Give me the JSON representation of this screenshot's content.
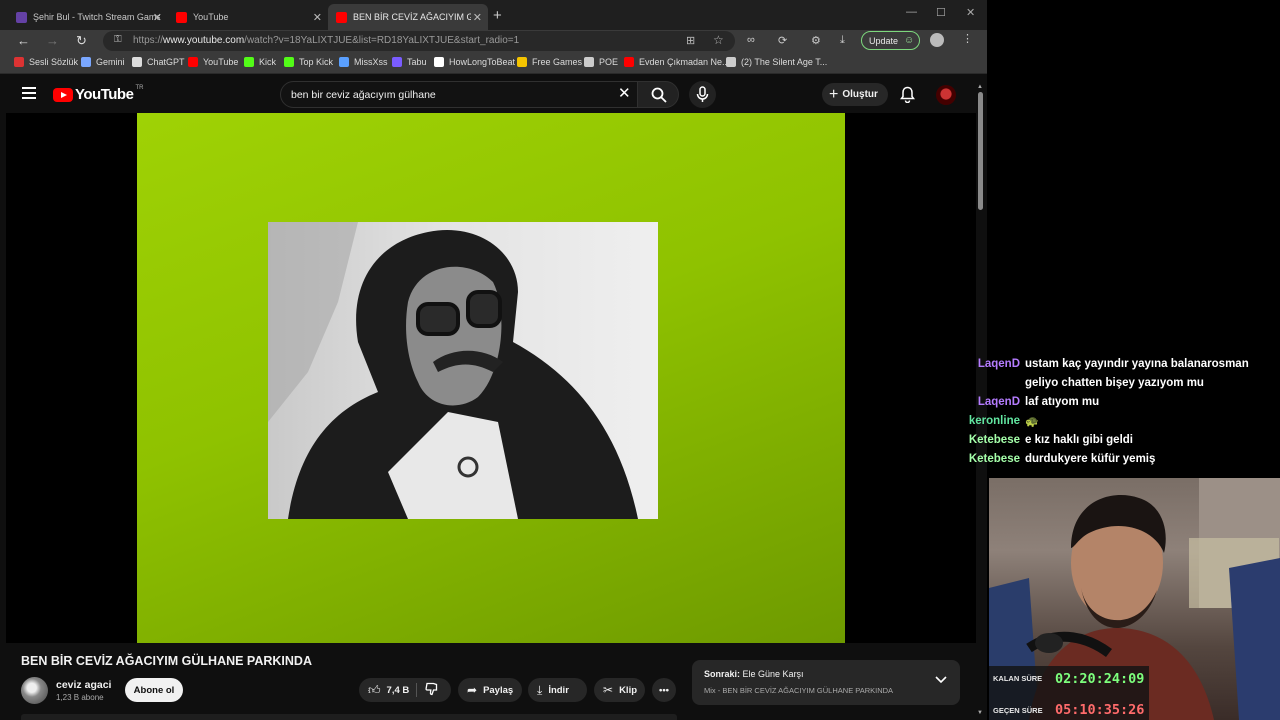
{
  "browser": {
    "tabs": [
      {
        "label": "Şehir Bul - Twitch Stream Games",
        "icon": "twitch-icon",
        "active": false
      },
      {
        "label": "YouTube",
        "icon": "youtube-icon",
        "active": false
      },
      {
        "label": "BEN BİR CEVİZ AĞACIYIM GÜLHANE",
        "icon": "youtube-icon",
        "active": true
      }
    ],
    "url_prefix": "https://",
    "url_domain": "www.youtube.com",
    "url_path": "/watch?v=18YaLIXTJUE&list=RD18YaLIXTJUE&start_radio=1",
    "update_label": "Update",
    "bookmarks": [
      {
        "label": "Sesli Sözlük",
        "icon": "flag-icon",
        "color": "#d33"
      },
      {
        "label": "Gemini",
        "icon": "gemini-icon",
        "color": "#7aa7ff"
      },
      {
        "label": "ChatGPT",
        "icon": "chatgpt-icon",
        "color": "#ddd"
      },
      {
        "label": "YouTube",
        "icon": "youtube-icon",
        "color": "#f00"
      },
      {
        "label": "Kick",
        "icon": "kick-icon",
        "color": "#53fc18"
      },
      {
        "label": "Top Kick",
        "icon": "kick-icon",
        "color": "#53fc18"
      },
      {
        "label": "MissXss",
        "icon": "missxss-icon",
        "color": "#5aa0ff"
      },
      {
        "label": "Tabu",
        "icon": "tabu-icon",
        "color": "#7a5cff"
      },
      {
        "label": "HowLongToBeat",
        "icon": "hltb-icon",
        "color": "#fff"
      },
      {
        "label": "Free Games",
        "icon": "free-games-icon",
        "color": "#f5c400"
      },
      {
        "label": "POE",
        "icon": "folder-icon",
        "color": "#ccc"
      },
      {
        "label": "Evden Çıkmadan Ne...",
        "icon": "youtube-icon",
        "color": "#f00"
      },
      {
        "label": "(2) The Silent Age T...",
        "icon": "globe-icon",
        "color": "#ccc"
      }
    ]
  },
  "youtube": {
    "logo_text": "YouTube",
    "logo_region": "TR",
    "search_query": "ben bir ceviz ağacıyım gülhane",
    "create_label": "Oluştur",
    "video_title": "BEN BİR CEVİZ AĞACIYIM GÜLHANE PARKINDA",
    "channel_name": "ceviz agaci",
    "channel_subs": "1,23 B abone",
    "subscribe_label": "Abone ol",
    "likes": "7,4 B",
    "share_label": "Paylaş",
    "download_label": "İndir",
    "clip_label": "Klip",
    "next_prefix": "Sonraki:",
    "next_title": "Ele Güne Karşı",
    "next_mix": "Mix - BEN BİR CEVİZ AĞACIYIM GÜLHANE PARKINDA",
    "video_bg_color": "#9fd205"
  },
  "chat": [
    {
      "user": "LaqenD",
      "color": "#b57cff",
      "text": "ustam kaç yayındır yayına balanarosman"
    },
    {
      "user": "",
      "color": "#b57cff",
      "text": "geliyo chatten bişey yazıyom mu"
    },
    {
      "user": "LaqenD",
      "color": "#b57cff",
      "text": "laf atıyom mu"
    },
    {
      "user": "keronline",
      "color": "#62e6a1",
      "text": ""
    },
    {
      "user": "Ketebese",
      "color": "#a5ffaa",
      "text": "e kız haklı gibi geldi"
    },
    {
      "user": "Ketebese",
      "color": "#a5ffaa",
      "text": "durdukyere küfür yemiş"
    }
  ],
  "timers": {
    "remaining_label": "KALAN SÜRE",
    "remaining_value": "02:20:24:09",
    "remaining_color": "#7dff7d",
    "elapsed_label": "GEÇEN SÜRE",
    "elapsed_value": "05:10:35:26",
    "elapsed_color": "#ff6b6b"
  }
}
